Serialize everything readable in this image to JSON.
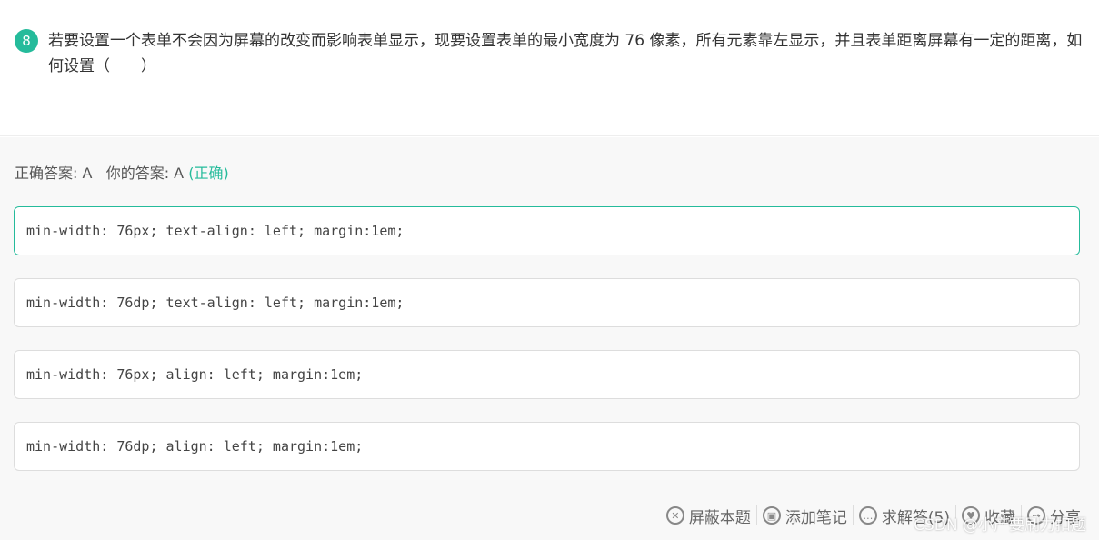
{
  "question": {
    "number": "8",
    "text": "若要设置一个表单不会因为屏幕的改变而影响表单显示，现要设置表单的最小宽度为 76 像素，所有元素靠左显示，并且表单距离屏幕有一定的距离，如何设置（　　）"
  },
  "result": {
    "correct_label": "正确答案: A",
    "your_label": "你的答案: A",
    "status": "(正确)"
  },
  "options": [
    {
      "text": "min-width: 76px; text-align: left; margin:1em;",
      "selected": true
    },
    {
      "text": "min-width: 76dp; text-align: left; margin:1em;",
      "selected": false
    },
    {
      "text": "min-width: 76px; align: left; margin:1em;",
      "selected": false
    },
    {
      "text": "min-width: 76dp; align: left; margin:1em;",
      "selected": false
    }
  ],
  "footer": {
    "block": "屏蔽本题",
    "note": "添加笔记",
    "ask": "求解答(5)",
    "favorite": "收藏",
    "share": "分享"
  },
  "watermark": "CSDN @小产要刷力扣题",
  "colors": {
    "accent": "#25bb9b",
    "background": "#f8f8f8"
  }
}
